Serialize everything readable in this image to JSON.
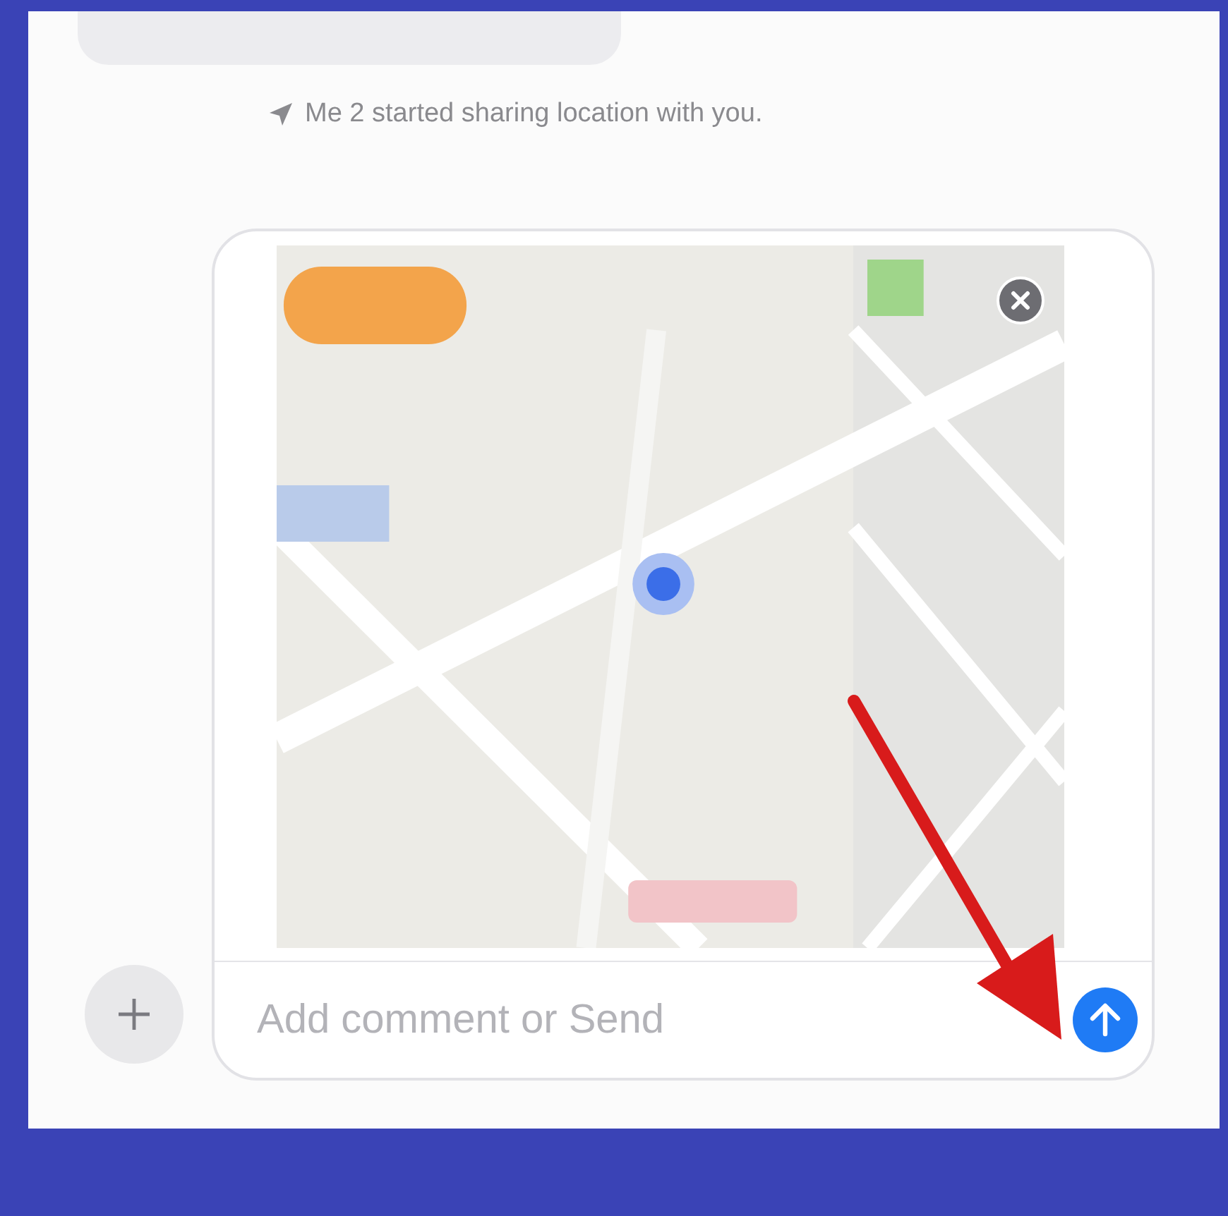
{
  "notice": {
    "text": "Me 2 started sharing location with you."
  },
  "composer": {
    "placeholder": "Add comment or Send"
  }
}
